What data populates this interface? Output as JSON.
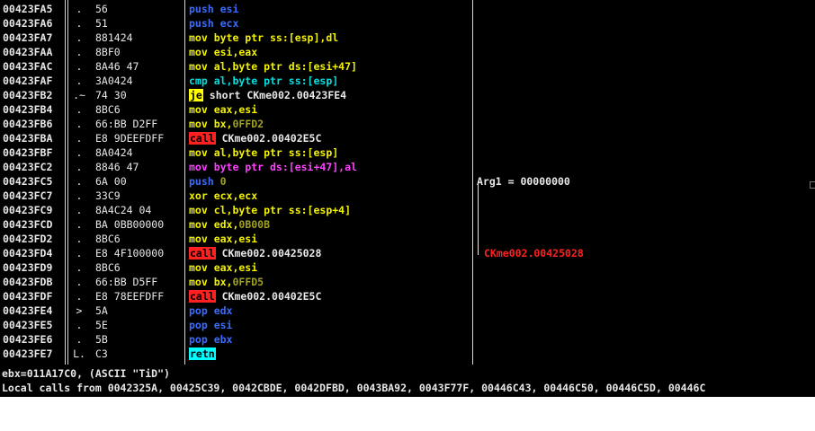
{
  "rows": [
    {
      "addr": "00423FA5",
      "mark": ".",
      "hex": "56",
      "asm": [
        {
          "t": "push esi",
          "c": "t-blue"
        }
      ]
    },
    {
      "addr": "00423FA6",
      "mark": ".",
      "hex": "51",
      "asm": [
        {
          "t": "push ecx",
          "c": "t-blue"
        }
      ]
    },
    {
      "addr": "00423FA7",
      "mark": ".",
      "hex": "881424",
      "asm": [
        {
          "t": "mov byte ptr ss:[esp],dl",
          "c": "t-yellow"
        }
      ]
    },
    {
      "addr": "00423FAA",
      "mark": ".",
      "hex": "8BF0",
      "asm": [
        {
          "t": "mov esi,eax",
          "c": "t-yellow"
        }
      ]
    },
    {
      "addr": "00423FAC",
      "mark": ".",
      "hex": "8A46 47",
      "asm": [
        {
          "t": "mov al,byte ptr ds:[esi+47]",
          "c": "t-yellow"
        }
      ]
    },
    {
      "addr": "00423FAF",
      "mark": ".",
      "hex": "3A0424",
      "asm": [
        {
          "t": "cmp al,byte ptr ss:[esp]",
          "c": "t-cyan"
        }
      ]
    },
    {
      "addr": "00423FB2",
      "mark": ".~",
      "hex": "74 30",
      "asm": [
        {
          "t": "je",
          "c": "bg-yellow"
        },
        {
          "t": " short CKme002.00423FE4",
          "c": "t-white"
        }
      ]
    },
    {
      "addr": "00423FB4",
      "mark": ".",
      "hex": "8BC6",
      "asm": [
        {
          "t": "mov eax,esi",
          "c": "t-yellow"
        }
      ]
    },
    {
      "addr": "00423FB6",
      "mark": ".",
      "hex": "66:BB D2FF",
      "asm": [
        {
          "t": "mov bx,",
          "c": "t-yellow"
        },
        {
          "t": "0FFD2",
          "c": "t-olive"
        }
      ]
    },
    {
      "addr": "00423FBA",
      "mark": ".",
      "hex": "E8 9DEEFDFF",
      "asm": [
        {
          "t": "call",
          "c": "bg-red"
        },
        {
          "t": " CKme002.00402E5C",
          "c": "t-white"
        }
      ]
    },
    {
      "addr": "00423FBF",
      "mark": ".",
      "hex": "8A0424",
      "asm": [
        {
          "t": "mov al,byte ptr ss:[esp]",
          "c": "t-yellow"
        }
      ]
    },
    {
      "addr": "00423FC2",
      "mark": ".",
      "hex": "8846 47",
      "asm": [
        {
          "t": "mov byte ptr ds:[esi+47],al",
          "c": "t-magenta"
        }
      ]
    },
    {
      "addr": "00423FC5",
      "mark": ".",
      "hex": "6A 00",
      "asm": [
        {
          "t": "push ",
          "c": "t-blue"
        },
        {
          "t": "0",
          "c": "t-olive"
        }
      ]
    },
    {
      "addr": "00423FC7",
      "mark": ".",
      "hex": "33C9",
      "asm": [
        {
          "t": "xor ecx,ecx",
          "c": "t-yellow"
        }
      ]
    },
    {
      "addr": "00423FC9",
      "mark": ".",
      "hex": "8A4C24 04",
      "asm": [
        {
          "t": "mov cl,byte ptr ss:[esp+4]",
          "c": "t-yellow"
        }
      ]
    },
    {
      "addr": "00423FCD",
      "mark": ".",
      "hex": "BA 0BB00000",
      "asm": [
        {
          "t": "mov edx,",
          "c": "t-yellow"
        },
        {
          "t": "0B00B",
          "c": "t-olive"
        }
      ]
    },
    {
      "addr": "00423FD2",
      "mark": ".",
      "hex": "8BC6",
      "asm": [
        {
          "t": "mov eax,esi",
          "c": "t-yellow"
        }
      ]
    },
    {
      "addr": "00423FD4",
      "mark": ".",
      "hex": "E8 4F100000",
      "asm": [
        {
          "t": "call",
          "c": "bg-red"
        },
        {
          "t": " CKme002.00425028",
          "c": "t-white"
        }
      ]
    },
    {
      "addr": "00423FD9",
      "mark": ".",
      "hex": "8BC6",
      "asm": [
        {
          "t": "mov eax,esi",
          "c": "t-yellow"
        }
      ]
    },
    {
      "addr": "00423FDB",
      "mark": ".",
      "hex": "66:BB D5FF",
      "asm": [
        {
          "t": "mov bx,",
          "c": "t-yellow"
        },
        {
          "t": "0FFD5",
          "c": "t-olive"
        }
      ]
    },
    {
      "addr": "00423FDF",
      "mark": ".",
      "hex": "E8 78EEFDFF",
      "asm": [
        {
          "t": "call",
          "c": "bg-red"
        },
        {
          "t": " CKme002.00402E5C",
          "c": "t-white"
        }
      ]
    },
    {
      "addr": "00423FE4",
      "mark": ">",
      "hex": "5A",
      "asm": [
        {
          "t": "pop edx",
          "c": "t-blue"
        }
      ]
    },
    {
      "addr": "00423FE5",
      "mark": ".",
      "hex": "5E",
      "asm": [
        {
          "t": "pop esi",
          "c": "t-blue"
        }
      ]
    },
    {
      "addr": "00423FE6",
      "mark": ".",
      "hex": "5B",
      "asm": [
        {
          "t": "pop ebx",
          "c": "t-blue"
        }
      ]
    },
    {
      "addr": "00423FE7",
      "mark": "L.",
      "hex": "C3",
      "asm": [
        {
          "t": "retn",
          "c": "bg-cyan"
        }
      ]
    }
  ],
  "comments": {
    "arg1": "Arg1 = 00000000",
    "call_target": "CKme002.00425028"
  },
  "info": {
    "line1": "ebx=011A17C0, (ASCII \"TiD\")",
    "line2": "Local calls from 0042325A, 00425C39, 0042CBDE, 0042DFBD, 0043BA92, 0043F77F, 00446C43, 00446C50, 00446C5D, 00446C"
  },
  "colors": {
    "background": "#000000",
    "call_highlight": "#ff2020",
    "jump_highlight": "#ffff00",
    "ret_highlight": "#00ffff",
    "push_pop": "#3a6cff",
    "mov": "#f2f200",
    "comment_red": "#ff2020"
  }
}
